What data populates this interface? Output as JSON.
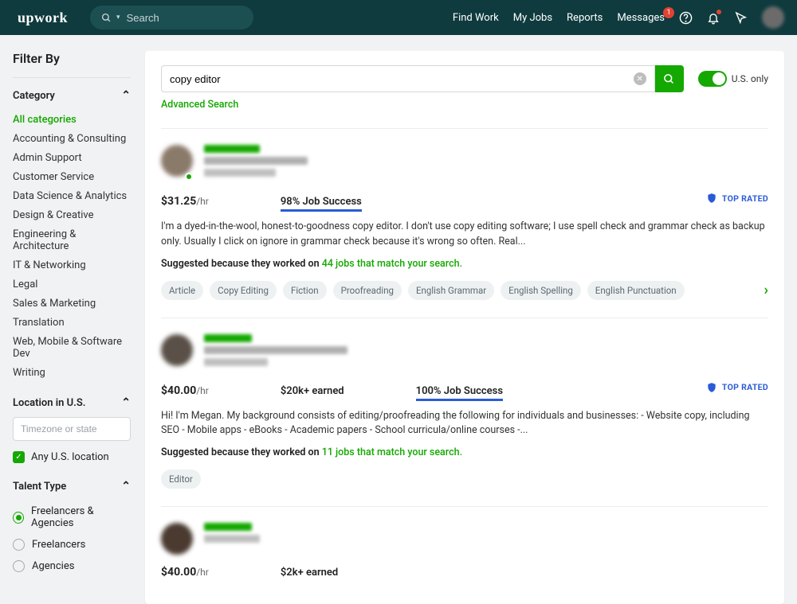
{
  "header": {
    "logo": "upwork",
    "search_placeholder": "Search",
    "nav": {
      "find_work": "Find Work",
      "my_jobs": "My Jobs",
      "reports": "Reports",
      "messages": "Messages",
      "messages_badge": "1"
    }
  },
  "sidebar": {
    "title": "Filter By",
    "category": {
      "heading": "Category",
      "items": [
        "All categories",
        "Accounting & Consulting",
        "Admin Support",
        "Customer Service",
        "Data Science & Analytics",
        "Design & Creative",
        "Engineering & Architecture",
        "IT & Networking",
        "Legal",
        "Sales & Marketing",
        "Translation",
        "Web, Mobile & Software Dev",
        "Writing"
      ],
      "selected_index": 0
    },
    "location": {
      "heading": "Location in U.S.",
      "placeholder": "Timezone or state",
      "any_label": "Any U.S. location"
    },
    "talent_type": {
      "heading": "Talent Type",
      "options": [
        "Freelancers & Agencies",
        "Freelancers",
        "Agencies"
      ],
      "selected_index": 0
    }
  },
  "search": {
    "value": "copy editor",
    "us_only_label": "U.S. only",
    "advanced": "Advanced Search"
  },
  "results": [
    {
      "rate": "$31.25",
      "per": "/hr",
      "earned": "",
      "job_success": "98% Job Success",
      "top_rated": "TOP RATED",
      "desc": "I'm a dyed-in-the-wool, honest-to-goodness copy editor. I don't use copy editing software; I use spell check and grammar check as backup only. Usually I click on ignore in grammar check because it's wrong so often. Real...",
      "sugg_prefix": "Suggested because they worked on ",
      "sugg_link": "44 jobs that match your search.",
      "tags": [
        "Article",
        "Copy Editing",
        "Fiction",
        "Proofreading",
        "English Grammar",
        "English Spelling",
        "English Punctuation"
      ],
      "show_online": true,
      "show_more_tags": true
    },
    {
      "rate": "$40.00",
      "per": "/hr",
      "earned": "$20k+ earned",
      "job_success": "100% Job Success",
      "top_rated": "TOP RATED",
      "desc": "Hi! I'm Megan. My background consists of editing/proofreading the following for individuals and businesses: - Website copy, including SEO - Mobile apps - eBooks - Academic papers - School curricula/online courses -...",
      "sugg_prefix": "Suggested because they worked on ",
      "sugg_link": "11 jobs that match your search.",
      "tags": [
        "Editor"
      ],
      "show_online": false,
      "show_more_tags": false
    },
    {
      "rate": "$40.00",
      "per": "/hr",
      "earned": "$2k+ earned",
      "job_success": "",
      "top_rated": "",
      "desc": "",
      "sugg_prefix": "",
      "sugg_link": "",
      "tags": [],
      "show_online": false,
      "show_more_tags": false
    }
  ]
}
